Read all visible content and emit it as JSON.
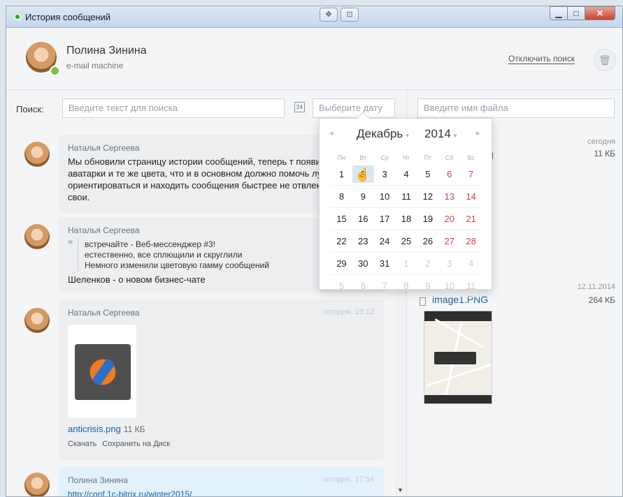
{
  "window": {
    "title": "История сообщений"
  },
  "header": {
    "name": "Полина Зинина",
    "subtitle": "e-mail machine",
    "disable_search": "Отключить поиск"
  },
  "search": {
    "label": "Поиск:",
    "text_placeholder": "Введите текст для поиска",
    "date_placeholder": "Выберите дату",
    "file_placeholder": "Введите имя файла",
    "calendar_icon_text": "24"
  },
  "messages": [
    {
      "author": "Наталья Сергеева",
      "time": "",
      "text": "Мы обновили страницу истории сообщений, теперь т появились аватарки и те же цвета, что и в основном должно помочь лучше ориентироваться и находить сообщения быстрее не отвлекаясь на свои."
    },
    {
      "author": "Наталья Сергеева",
      "time": "",
      "quote": [
        "встречайте - Веб-мессенджер #3!",
        "естественно, все сплющили и скруглили",
        "Немного изменили цветовую гамму сообщений"
      ],
      "text": "Шеленков - о новом бизнес-чате"
    },
    {
      "author": "Наталья Сергеева",
      "time": "сегодня, 19:12",
      "file": {
        "name": "anticrisis.png",
        "size": "11 КБ"
      },
      "actions": [
        "Скачать",
        "Сохранить на Диск"
      ]
    },
    {
      "author": "Полина Зинина",
      "time": "сегодня, 17:54",
      "link": "http://conf.1c-bitrix.ru/winter2015/"
    }
  ],
  "files": [
    {
      "name_partial": "g",
      "date": "сегодня",
      "size": "11 КБ",
      "author_partial": "а"
    },
    {
      "name": "image1.PNG",
      "date": "12.11.2014",
      "size": "264 КБ"
    }
  ],
  "calendar": {
    "month": "Декабрь",
    "year": "2014",
    "weekdays": [
      "Пн",
      "Вт",
      "Ср",
      "Чт",
      "Пт",
      "Сб",
      "Вс"
    ],
    "weeks": [
      [
        "1",
        "2",
        "3",
        "4",
        "5",
        "6",
        "7"
      ],
      [
        "8",
        "9",
        "10",
        "11",
        "12",
        "13",
        "14"
      ],
      [
        "15",
        "16",
        "17",
        "18",
        "19",
        "20",
        "21"
      ],
      [
        "22",
        "23",
        "24",
        "25",
        "26",
        "27",
        "28"
      ],
      [
        "29",
        "30",
        "31",
        "1",
        "2",
        "3",
        "4"
      ],
      [
        "5",
        "6",
        "7",
        "8",
        "9",
        "10",
        "11"
      ]
    ],
    "selected": "2"
  },
  "colors": {
    "accent_link": "#1a62a6",
    "weekend": "#d04040",
    "online": "#7cc243"
  }
}
